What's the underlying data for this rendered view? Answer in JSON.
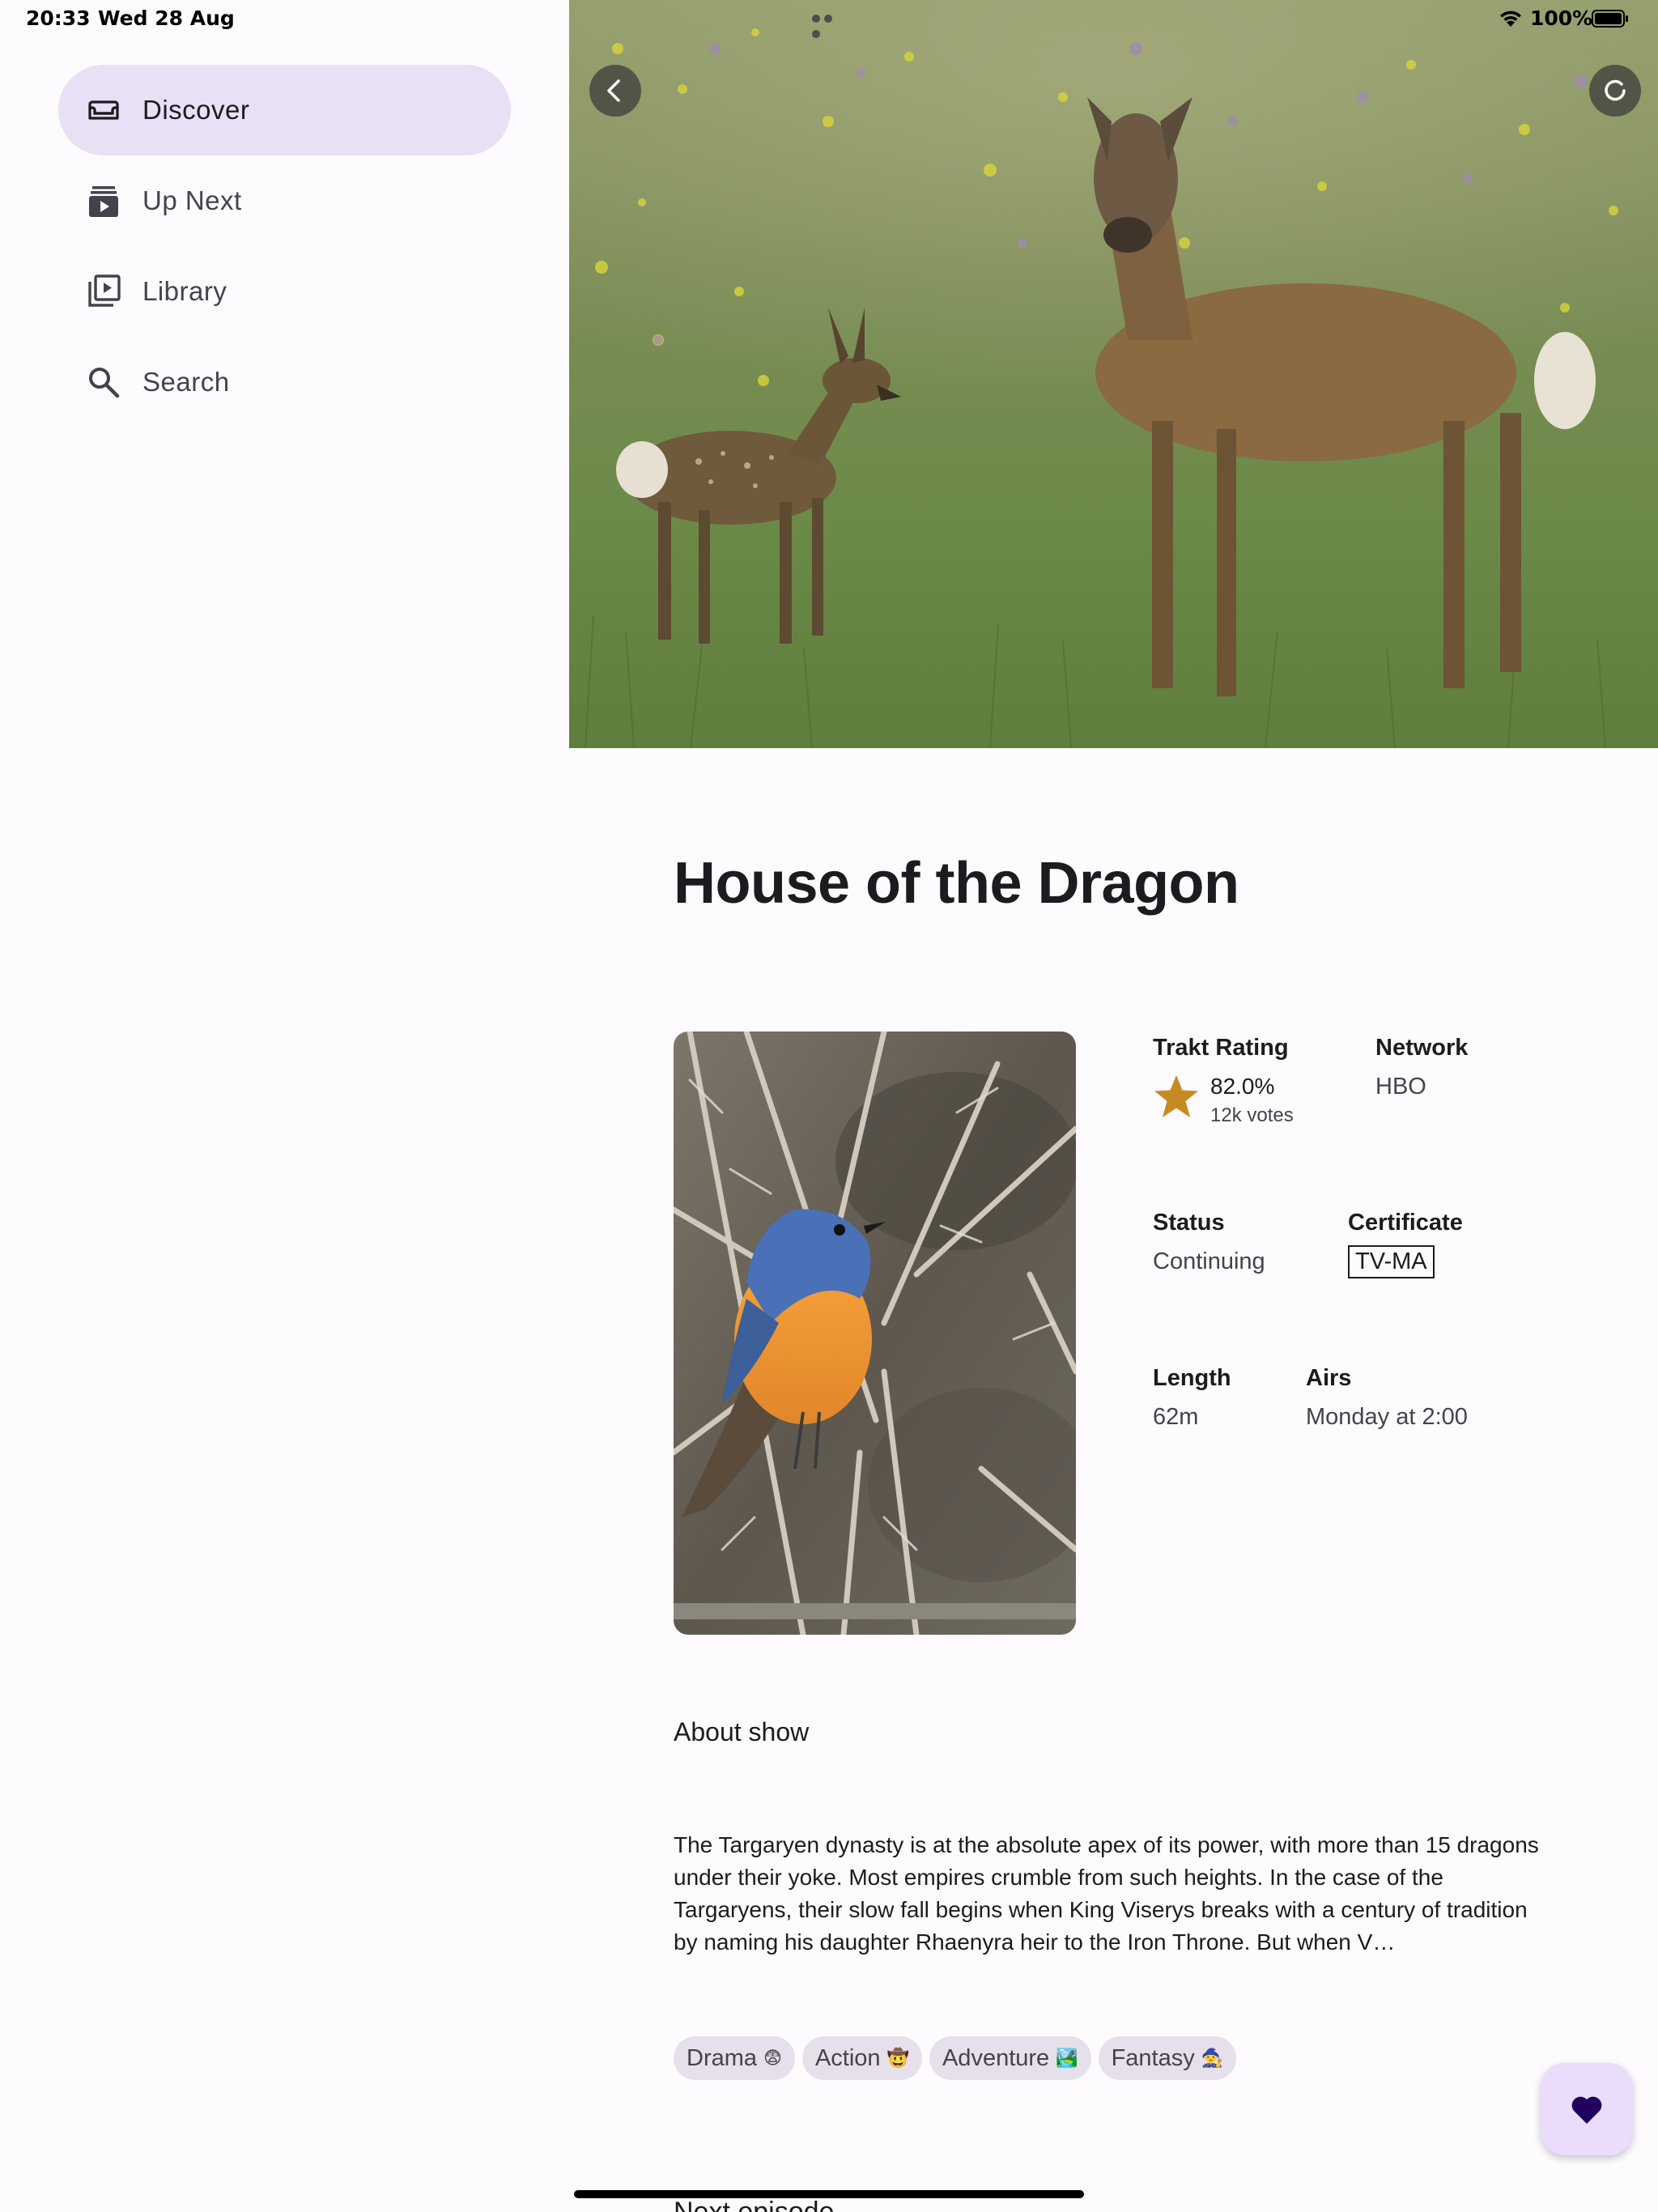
{
  "status_bar": {
    "time": "20:33",
    "date": "Wed 28 Aug",
    "battery": "100%"
  },
  "sidebar": {
    "items": [
      {
        "label": "Discover",
        "icon": "couch-icon",
        "active": true
      },
      {
        "label": "Up Next",
        "icon": "queue-play-icon",
        "active": false
      },
      {
        "label": "Library",
        "icon": "video-library-icon",
        "active": false
      },
      {
        "label": "Search",
        "icon": "search-icon",
        "active": false
      }
    ]
  },
  "show": {
    "title": "House of the Dragon",
    "trakt_rating_label": "Trakt Rating",
    "trakt_rating": "82.0%",
    "votes": "12k votes",
    "network_label": "Network",
    "network": "HBO",
    "status_label": "Status",
    "status": "Continuing",
    "certificate_label": "Certificate",
    "certificate": "TV-MA",
    "length_label": "Length",
    "length": "62m",
    "airs_label": "Airs",
    "airs": "Monday at 2:00",
    "about_heading": "About show",
    "overview": "The Targaryen dynasty is at the absolute apex of its power, with more than 15 dragons under their yoke. Most empires crumble from such heights. In the case of the Targaryens, their slow fall begins when King Viserys breaks with a century of tradition by naming his daughter Rhaenyra heir to the Iron Throne. But when V…",
    "genres": [
      {
        "label": "Drama",
        "emoji": "😨"
      },
      {
        "label": "Action",
        "emoji": "🤠"
      },
      {
        "label": "Adventure",
        "emoji": "🏞️"
      },
      {
        "label": "Fantasy",
        "emoji": "🧙"
      }
    ],
    "next_section_peek": "Next episode"
  },
  "colors": {
    "accent_container": "#e8e0f5",
    "star": "#c78a23",
    "fab": "#eadcfb",
    "fab_icon": "#21005d"
  }
}
